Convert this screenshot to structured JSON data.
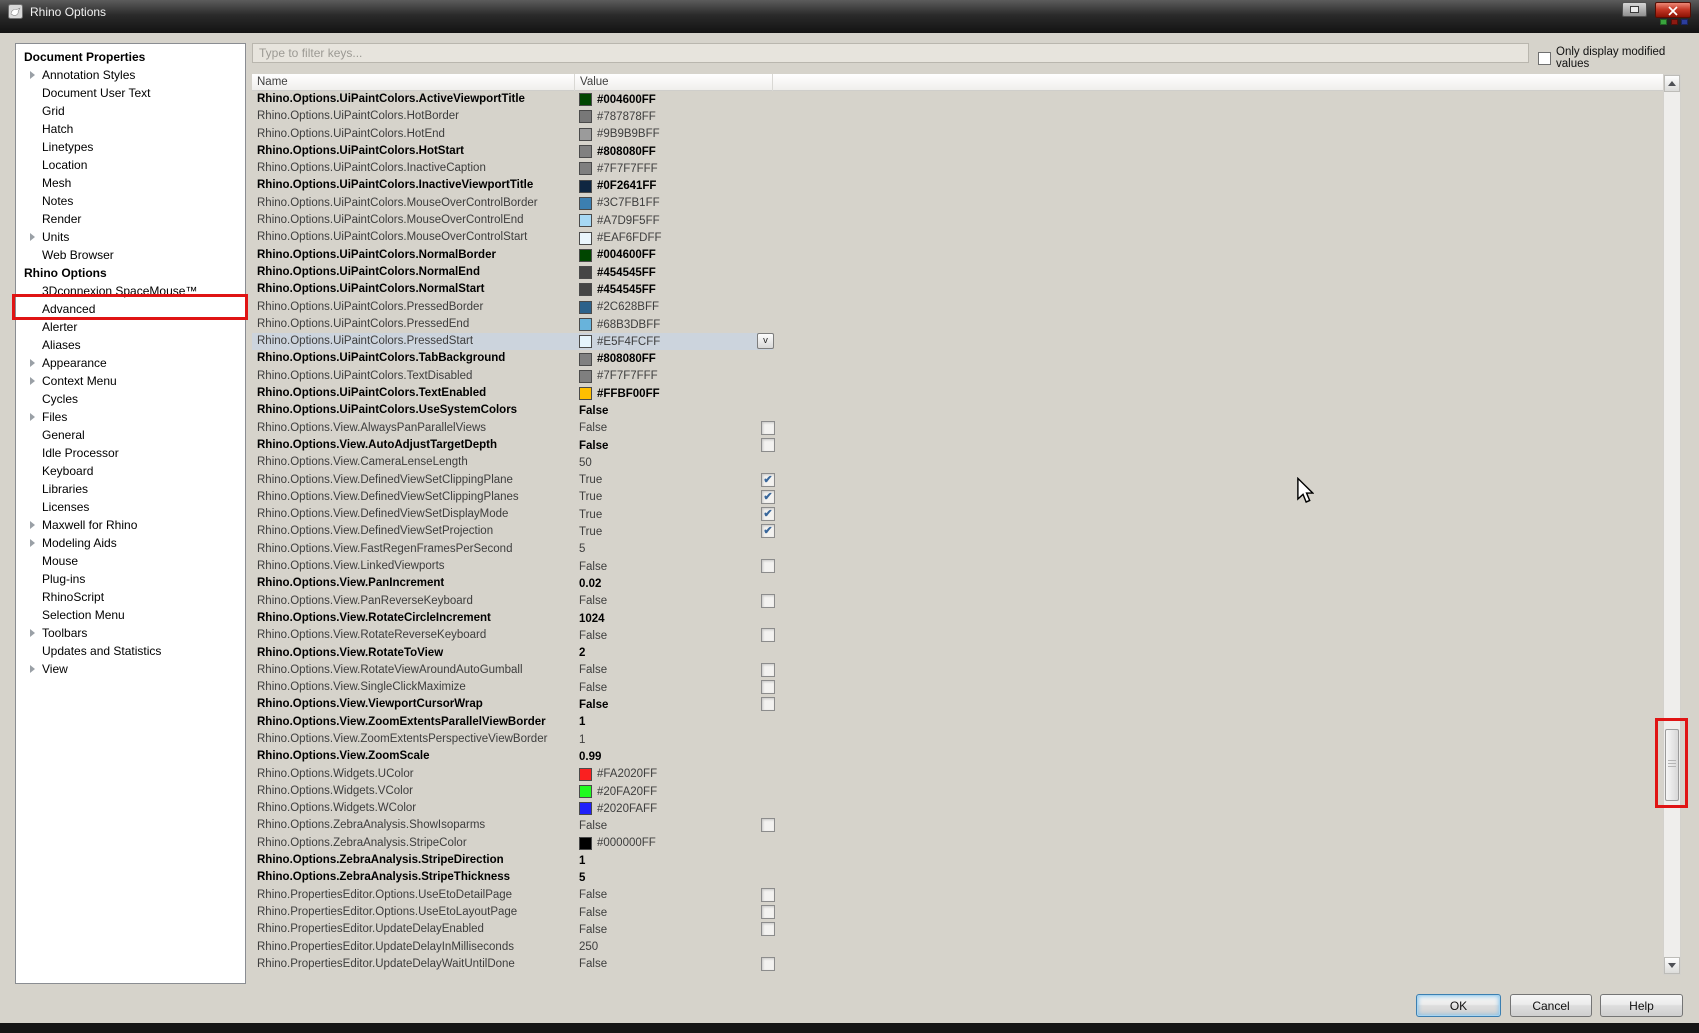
{
  "window": {
    "title": "Rhino Options",
    "dot_colors": [
      "#39a33d",
      "#8c1a12",
      "#2c3e9c"
    ]
  },
  "icons": {
    "dropdown_glyph": "v",
    "check_glyph": "✔"
  },
  "sidebar": {
    "sections": [
      {
        "header": "Document Properties",
        "items": [
          {
            "label": "Annotation Styles",
            "expandable": true
          },
          {
            "label": "Document User Text"
          },
          {
            "label": "Grid"
          },
          {
            "label": "Hatch"
          },
          {
            "label": "Linetypes"
          },
          {
            "label": "Location"
          },
          {
            "label": "Mesh"
          },
          {
            "label": "Notes"
          },
          {
            "label": "Render"
          },
          {
            "label": "Units",
            "expandable": true
          },
          {
            "label": "Web Browser"
          }
        ]
      },
      {
        "header": "Rhino Options",
        "items": [
          {
            "label": "3Dconnexion SpaceMouse™"
          },
          {
            "label": "Advanced"
          },
          {
            "label": "Alerter"
          },
          {
            "label": "Aliases"
          },
          {
            "label": "Appearance",
            "expandable": true
          },
          {
            "label": "Context Menu",
            "expandable": true
          },
          {
            "label": "Cycles"
          },
          {
            "label": "Files",
            "expandable": true
          },
          {
            "label": "General"
          },
          {
            "label": "Idle Processor"
          },
          {
            "label": "Keyboard"
          },
          {
            "label": "Libraries"
          },
          {
            "label": "Licenses"
          },
          {
            "label": "Maxwell for Rhino",
            "expandable": true
          },
          {
            "label": "Modeling Aids",
            "expandable": true
          },
          {
            "label": "Mouse"
          },
          {
            "label": "Plug-ins"
          },
          {
            "label": "RhinoScript"
          },
          {
            "label": "Selection Menu"
          },
          {
            "label": "Toolbars",
            "expandable": true
          },
          {
            "label": "Updates and Statistics"
          },
          {
            "label": "View",
            "expandable": true
          }
        ]
      }
    ]
  },
  "main": {
    "filter_placeholder": "Type to filter keys...",
    "modified_only_label": "Only display modified values",
    "columns": {
      "name": "Name",
      "value": "Value"
    }
  },
  "rows": [
    {
      "name": "Rhino.Options.UiPaintColors.ActiveViewportTitle",
      "type": "color",
      "value": "#004600FF",
      "bold": true
    },
    {
      "name": "Rhino.Options.UiPaintColors.HotBorder",
      "type": "color",
      "value": "#787878FF"
    },
    {
      "name": "Rhino.Options.UiPaintColors.HotEnd",
      "type": "color",
      "value": "#9B9B9BFF"
    },
    {
      "name": "Rhino.Options.UiPaintColors.HotStart",
      "type": "color",
      "value": "#808080FF",
      "bold": true
    },
    {
      "name": "Rhino.Options.UiPaintColors.InactiveCaption",
      "type": "color",
      "value": "#7F7F7FFF"
    },
    {
      "name": "Rhino.Options.UiPaintColors.InactiveViewportTitle",
      "type": "color",
      "value": "#0F2641FF",
      "bold": true
    },
    {
      "name": "Rhino.Options.UiPaintColors.MouseOverControlBorder",
      "type": "color",
      "value": "#3C7FB1FF"
    },
    {
      "name": "Rhino.Options.UiPaintColors.MouseOverControlEnd",
      "type": "color",
      "value": "#A7D9F5FF"
    },
    {
      "name": "Rhino.Options.UiPaintColors.MouseOverControlStart",
      "type": "color",
      "value": "#EAF6FDFF"
    },
    {
      "name": "Rhino.Options.UiPaintColors.NormalBorder",
      "type": "color",
      "value": "#004600FF",
      "bold": true
    },
    {
      "name": "Rhino.Options.UiPaintColors.NormalEnd",
      "type": "color",
      "value": "#454545FF",
      "bold": true
    },
    {
      "name": "Rhino.Options.UiPaintColors.NormalStart",
      "type": "color",
      "value": "#454545FF",
      "bold": true
    },
    {
      "name": "Rhino.Options.UiPaintColors.PressedBorder",
      "type": "color",
      "value": "#2C628BFF"
    },
    {
      "name": "Rhino.Options.UiPaintColors.PressedEnd",
      "type": "color",
      "value": "#68B3DBFF"
    },
    {
      "name": "Rhino.Options.UiPaintColors.PressedStart",
      "type": "color",
      "value": "#E5F4FCFF",
      "selected": true,
      "dropdown": true
    },
    {
      "name": "Rhino.Options.UiPaintColors.TabBackground",
      "type": "color",
      "value": "#808080FF",
      "bold": true
    },
    {
      "name": "Rhino.Options.UiPaintColors.TextDisabled",
      "type": "color",
      "value": "#7F7F7FFF"
    },
    {
      "name": "Rhino.Options.UiPaintColors.TextEnabled",
      "type": "color",
      "value": "#FFBF00FF",
      "bold": true
    },
    {
      "name": "Rhino.Options.UiPaintColors.UseSystemColors",
      "type": "text",
      "value": "False",
      "bold": true
    },
    {
      "name": "Rhino.Options.View.AlwaysPanParallelViews",
      "type": "bool",
      "value": "False",
      "checked": false
    },
    {
      "name": "Rhino.Options.View.AutoAdjustTargetDepth",
      "type": "bool",
      "value": "False",
      "checked": false,
      "bold": true
    },
    {
      "name": "Rhino.Options.View.CameraLenseLength",
      "type": "text",
      "value": "50"
    },
    {
      "name": "Rhino.Options.View.DefinedViewSetClippingPlane",
      "type": "bool",
      "value": "True",
      "checked": true
    },
    {
      "name": "Rhino.Options.View.DefinedViewSetClippingPlanes",
      "type": "bool",
      "value": "True",
      "checked": true
    },
    {
      "name": "Rhino.Options.View.DefinedViewSetDisplayMode",
      "type": "bool",
      "value": "True",
      "checked": true
    },
    {
      "name": "Rhino.Options.View.DefinedViewSetProjection",
      "type": "bool",
      "value": "True",
      "checked": true
    },
    {
      "name": "Rhino.Options.View.FastRegenFramesPerSecond",
      "type": "text",
      "value": "5"
    },
    {
      "name": "Rhino.Options.View.LinkedViewports",
      "type": "bool",
      "value": "False",
      "checked": false
    },
    {
      "name": "Rhino.Options.View.PanIncrement",
      "type": "text",
      "value": "0.02",
      "bold": true
    },
    {
      "name": "Rhino.Options.View.PanReverseKeyboard",
      "type": "bool",
      "value": "False",
      "checked": false
    },
    {
      "name": "Rhino.Options.View.RotateCircleIncrement",
      "type": "text",
      "value": "1024",
      "bold": true
    },
    {
      "name": "Rhino.Options.View.RotateReverseKeyboard",
      "type": "bool",
      "value": "False",
      "checked": false
    },
    {
      "name": "Rhino.Options.View.RotateToView",
      "type": "text",
      "value": "2",
      "bold": true
    },
    {
      "name": "Rhino.Options.View.RotateViewAroundAutoGumball",
      "type": "bool",
      "value": "False",
      "checked": false
    },
    {
      "name": "Rhino.Options.View.SingleClickMaximize",
      "type": "bool",
      "value": "False",
      "checked": false
    },
    {
      "name": "Rhino.Options.View.ViewportCursorWrap",
      "type": "bool",
      "value": "False",
      "checked": false,
      "bold": true
    },
    {
      "name": "Rhino.Options.View.ZoomExtentsParallelViewBorder",
      "type": "text",
      "value": "1",
      "bold": true
    },
    {
      "name": "Rhino.Options.View.ZoomExtentsPerspectiveViewBorder",
      "type": "text",
      "value": "1"
    },
    {
      "name": "Rhino.Options.View.ZoomScale",
      "type": "text",
      "value": "0.99",
      "bold": true
    },
    {
      "name": "Rhino.Options.Widgets.UColor",
      "type": "color",
      "value": "#FA2020FF"
    },
    {
      "name": "Rhino.Options.Widgets.VColor",
      "type": "color",
      "value": "#20FA20FF"
    },
    {
      "name": "Rhino.Options.Widgets.WColor",
      "type": "color",
      "value": "#2020FAFF"
    },
    {
      "name": "Rhino.Options.ZebraAnalysis.ShowIsoparms",
      "type": "bool",
      "value": "False",
      "checked": false
    },
    {
      "name": "Rhino.Options.ZebraAnalysis.StripeColor",
      "type": "color",
      "value": "#000000FF"
    },
    {
      "name": "Rhino.Options.ZebraAnalysis.StripeDirection",
      "type": "text",
      "value": "1",
      "bold": true
    },
    {
      "name": "Rhino.Options.ZebraAnalysis.StripeThickness",
      "type": "text",
      "value": "5",
      "bold": true
    },
    {
      "name": "Rhino.PropertiesEditor.Options.UseEtoDetailPage",
      "type": "bool",
      "value": "False",
      "checked": false
    },
    {
      "name": "Rhino.PropertiesEditor.Options.UseEtoLayoutPage",
      "type": "bool",
      "value": "False",
      "checked": false
    },
    {
      "name": "Rhino.PropertiesEditor.UpdateDelayEnabled",
      "type": "bool",
      "value": "False",
      "checked": false
    },
    {
      "name": "Rhino.PropertiesEditor.UpdateDelayInMilliseconds",
      "type": "text",
      "value": "250"
    },
    {
      "name": "Rhino.PropertiesEditor.UpdateDelayWaitUntilDone",
      "type": "bool",
      "value": "False",
      "checked": false
    }
  ],
  "footer": {
    "ok_label": "OK",
    "cancel_label": "Cancel",
    "help_label": "Help"
  },
  "annotations": {
    "color": "#e01414",
    "targets": [
      "advanced-sidebar-item",
      "table-scrollbar-thumb"
    ]
  }
}
